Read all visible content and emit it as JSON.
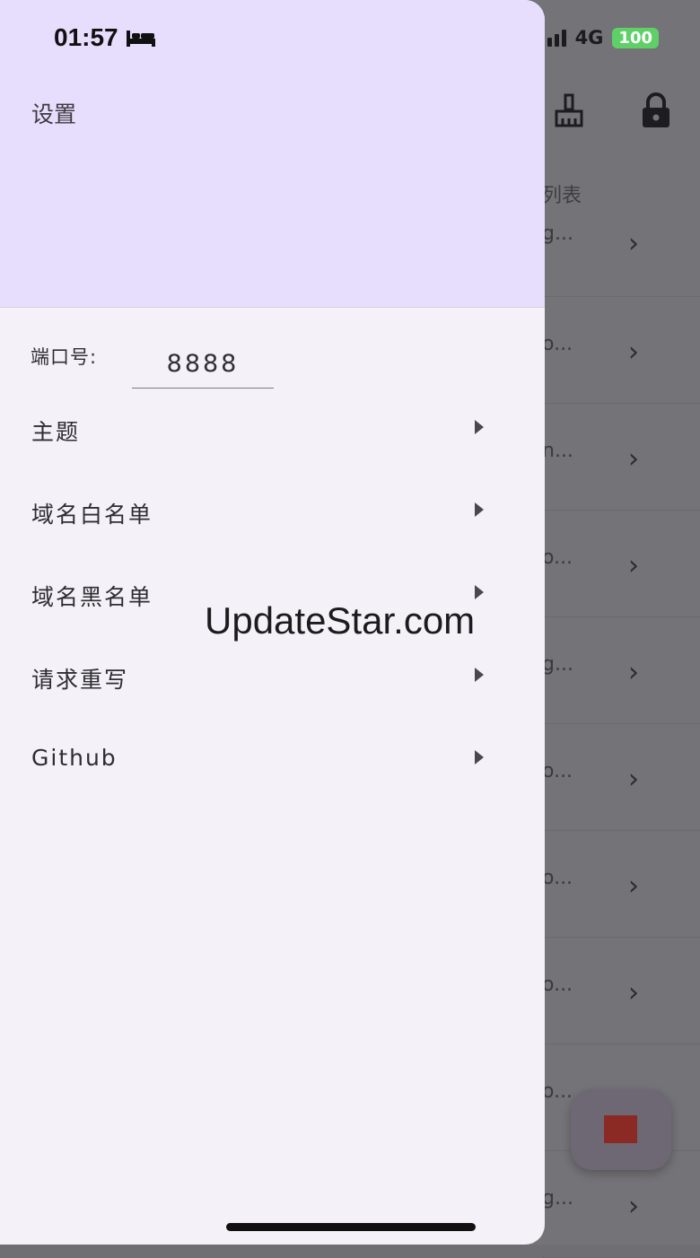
{
  "status_bar": {
    "time": "01:57",
    "network": "4G",
    "battery": "100"
  },
  "drawer": {
    "title": "设置",
    "port": {
      "label": "端口号:",
      "value": "8888"
    },
    "menu_items": [
      {
        "label": "主题"
      },
      {
        "label": "域名白名单"
      },
      {
        "label": "域名黑名单"
      },
      {
        "label": "请求重写"
      },
      {
        "label": "Github"
      }
    ]
  },
  "background": {
    "caption": "列表",
    "row_ellipses": [
      "g...",
      "o...",
      "n...",
      "o...",
      "g...",
      "o...",
      "o...",
      "o...",
      "o...",
      "g..."
    ],
    "icons": [
      "broom-icon",
      "lock-icon",
      "stop-icon"
    ]
  },
  "watermark": "UpdateStar.com",
  "colors": {
    "drawer_header": "#e7defd",
    "drawer_body": "#f4f2f8",
    "scrim": "#747377",
    "stop_button": "#8b2a24",
    "battery": "#5fd068"
  }
}
